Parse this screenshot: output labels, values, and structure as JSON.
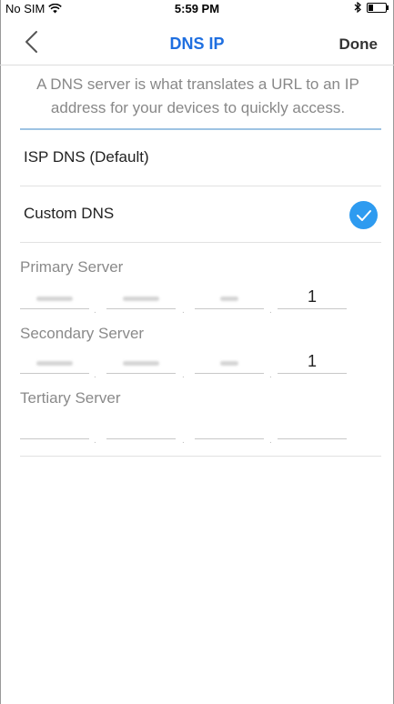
{
  "status_bar": {
    "carrier": "No SIM",
    "time": "5:59 PM"
  },
  "nav": {
    "title": "DNS IP",
    "done_label": "Done"
  },
  "description": "A DNS server is what translates a URL to an IP address for your devices to quickly access.",
  "options": [
    {
      "label": "ISP DNS (Default)",
      "selected": false
    },
    {
      "label": "Custom DNS",
      "selected": true
    }
  ],
  "servers": {
    "primary": {
      "label": "Primary Server",
      "octets": [
        "",
        "",
        "",
        "1"
      ]
    },
    "secondary": {
      "label": "Secondary Server",
      "octets": [
        "",
        "",
        "",
        "1"
      ]
    },
    "tertiary": {
      "label": "Tertiary Server",
      "octets": [
        "",
        "",
        "",
        ""
      ]
    }
  },
  "colors": {
    "accent": "#1f6fe0",
    "check": "#2e9bf0"
  }
}
